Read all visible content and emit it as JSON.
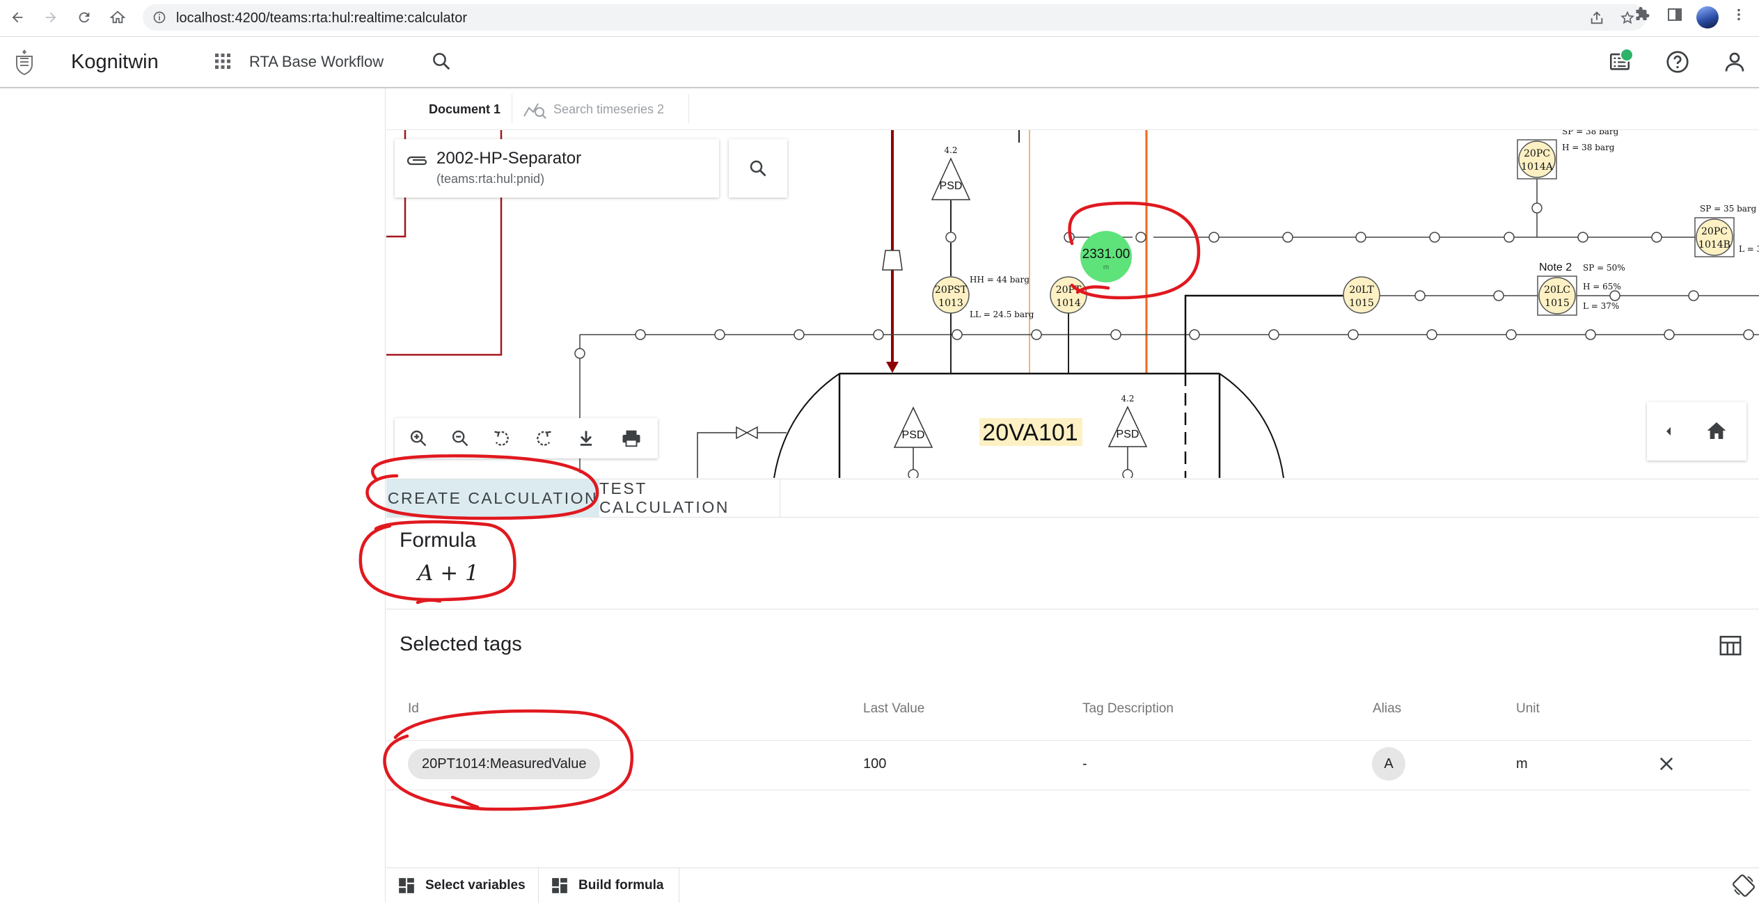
{
  "browser": {
    "url": "localhost:4200/teams:rta:hul:realtime:calculator"
  },
  "app": {
    "title": "Kognitwin",
    "workflow": "RTA Base Workflow"
  },
  "document_tabs": [
    {
      "label": "Document 1"
    },
    {
      "label": "Search timeseries 2"
    }
  ],
  "document": {
    "name": "2002-HP-Separator",
    "subtitle": "(teams:rta:hul:pnid)"
  },
  "pid": {
    "vessel": "20VA101",
    "value_bubble": "2331.00",
    "value_unit": "m",
    "note": "Note 2",
    "instruments": [
      {
        "l1": "20PST",
        "l2": "1013"
      },
      {
        "l1": "20PT",
        "l2": "1014"
      },
      {
        "l1": "20LT",
        "l2": "1015"
      },
      {
        "l1": "20LC",
        "l2": "1015"
      },
      {
        "l1": "20PC",
        "l2": "1014A"
      },
      {
        "l1": "20PC",
        "l2": "1014B"
      }
    ],
    "psd": "PSD",
    "psd_num": "4.2",
    "hh": "HH = 44 barg",
    "ll": "LL = 24.5 barg",
    "sp35": "SP = 35 barg",
    "sp38": "SP = 38 barg",
    "h38": "H = 38 barg",
    "sp50": "SP = 50%",
    "h65": "H = 65%",
    "l37": "L = 37%",
    "l3": "L = 3"
  },
  "calc_tabs": [
    {
      "label": "CREATE CALCULATION",
      "active": true
    },
    {
      "label": "TEST CALCULATION",
      "active": false
    }
  ],
  "formula": {
    "label": "Formula",
    "expression": "A + 1"
  },
  "selected_tags": {
    "title": "Selected tags",
    "columns": [
      "Id",
      "Last Value",
      "Tag Description",
      "Alias",
      "Unit"
    ],
    "rows": [
      {
        "id": "20PT1014:MeasuredValue",
        "last_value": "100",
        "description": "-",
        "alias": "A",
        "unit": "m"
      }
    ]
  },
  "bottom_bar": {
    "select_variables": "Select variables",
    "build_formula": "Build formula"
  },
  "colors": {
    "annotation": "#e0191f",
    "active_tab": "#dcebf0",
    "value_bubble": "#5ee37a",
    "instrument_fill": "#fdf1c4"
  }
}
